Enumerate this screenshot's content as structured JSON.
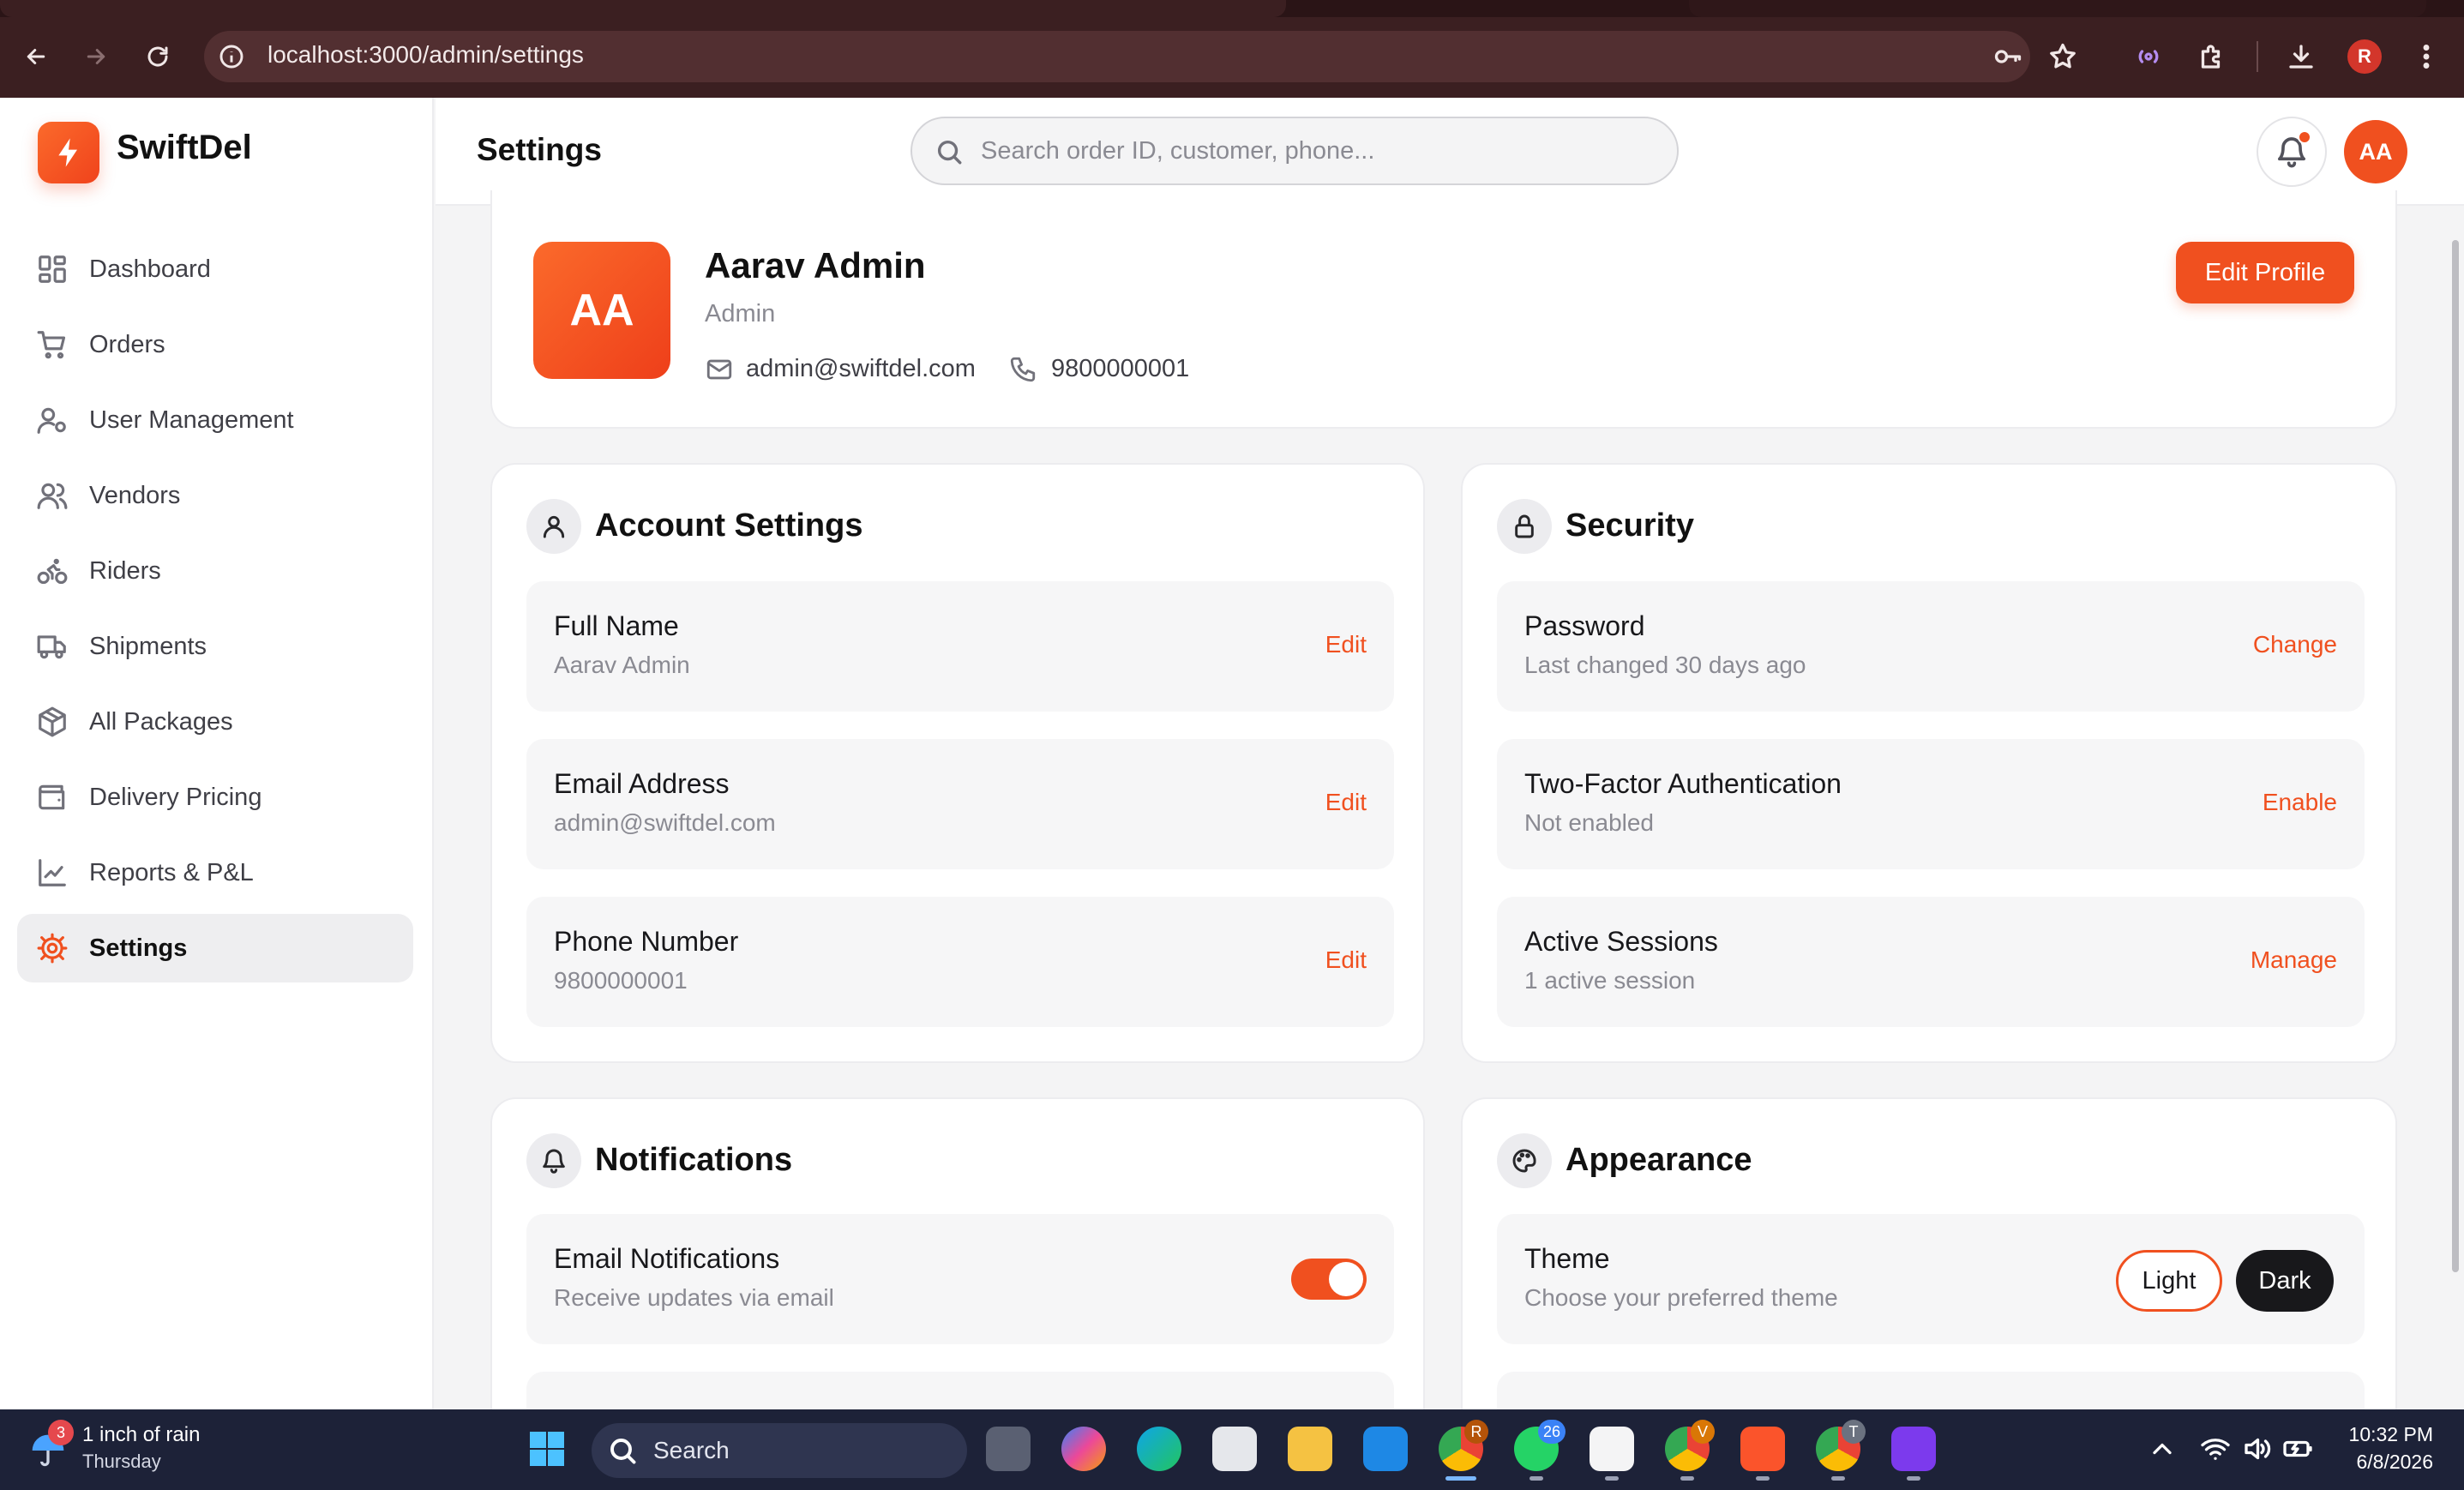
{
  "browser": {
    "url": "localhost:3000/admin/settings",
    "profile_initial": "R"
  },
  "app": {
    "brand": "SwiftDel",
    "page_title": "Settings",
    "search_placeholder": "Search order ID, customer, phone...",
    "user_initials": "AA",
    "accent_color": "#f0501f"
  },
  "sidebar": {
    "items": [
      {
        "label": "Dashboard",
        "icon": "dashboard-icon"
      },
      {
        "label": "Orders",
        "icon": "cart-icon"
      },
      {
        "label": "User Management",
        "icon": "user-gear-icon"
      },
      {
        "label": "Vendors",
        "icon": "users-icon"
      },
      {
        "label": "Riders",
        "icon": "bike-icon"
      },
      {
        "label": "Shipments",
        "icon": "truck-icon"
      },
      {
        "label": "All Packages",
        "icon": "package-icon"
      },
      {
        "label": "Delivery Pricing",
        "icon": "wallet-icon"
      },
      {
        "label": "Reports & P&L",
        "icon": "chart-line-icon"
      },
      {
        "label": "Settings",
        "icon": "gear-icon",
        "active": true
      }
    ]
  },
  "profile": {
    "initials": "AA",
    "name": "Aarav Admin",
    "role": "Admin",
    "email": "admin@swiftdel.com",
    "phone": "9800000001",
    "edit_label": "Edit Profile"
  },
  "account_settings": {
    "title": "Account Settings",
    "rows": [
      {
        "label": "Full Name",
        "value": "Aarav Admin",
        "action": "Edit"
      },
      {
        "label": "Email Address",
        "value": "admin@swiftdel.com",
        "action": "Edit"
      },
      {
        "label": "Phone Number",
        "value": "9800000001",
        "action": "Edit"
      }
    ]
  },
  "security": {
    "title": "Security",
    "rows": [
      {
        "label": "Password",
        "value": "Last changed 30 days ago",
        "action": "Change"
      },
      {
        "label": "Two-Factor Authentication",
        "value": "Not enabled",
        "action": "Enable"
      },
      {
        "label": "Active Sessions",
        "value": "1 active session",
        "action": "Manage"
      }
    ]
  },
  "notifications": {
    "title": "Notifications",
    "rows": [
      {
        "label": "Email Notifications",
        "value": "Receive updates via email",
        "enabled": true
      }
    ]
  },
  "appearance": {
    "title": "Appearance",
    "theme_label": "Theme",
    "theme_sub": "Choose your preferred theme",
    "options": [
      "Light",
      "Dark"
    ],
    "selected": "Light"
  },
  "taskbar": {
    "weather_badge": "3",
    "weather_line1": "1 inch of rain",
    "weather_line2": "Thursday",
    "search_label": "Search",
    "whatsapp_badge": "26",
    "chrome1_badge": "R",
    "chrome2_badge": "V",
    "chrome3_badge": "T",
    "time": "10:32 PM",
    "date": "6/8/2026"
  }
}
